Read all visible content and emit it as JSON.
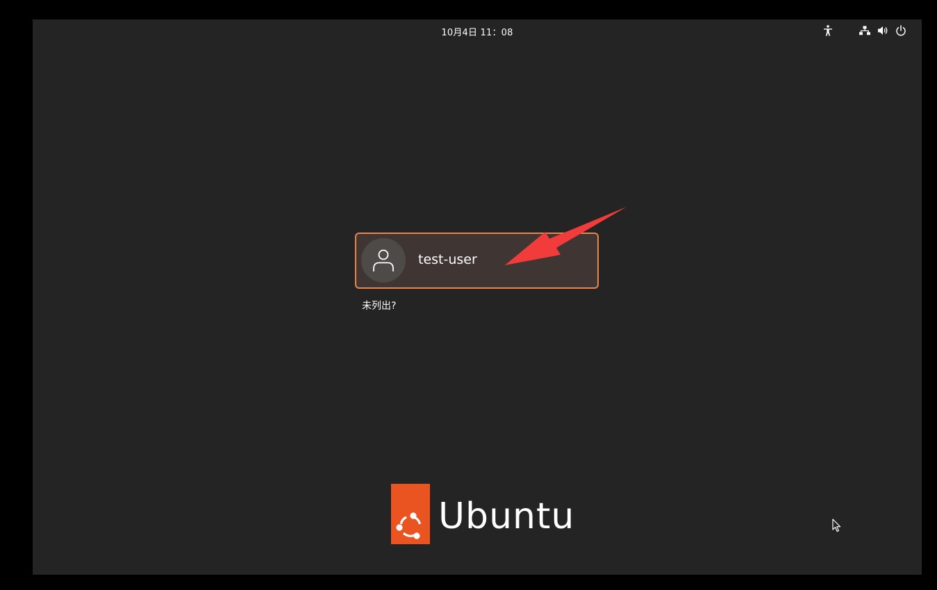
{
  "topbar": {
    "clock": "10月4日  11：08",
    "icons": [
      "accessibility-icon",
      "network-icon",
      "volume-icon",
      "power-icon"
    ]
  },
  "login": {
    "user_name": "test-user",
    "not_listed": "未列出?"
  },
  "branding": {
    "logo_text": "Ubuntu"
  },
  "colors": {
    "background": "#242424",
    "card_background": "#3f3532",
    "card_border": "#e9854e",
    "ubuntu_orange": "#e95420",
    "annotation_arrow": "#f23c3c"
  }
}
